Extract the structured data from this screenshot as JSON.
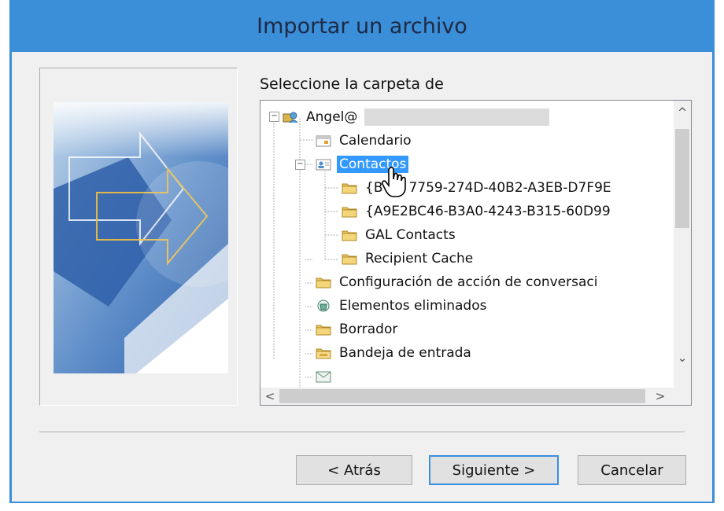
{
  "window": {
    "title": "Importar un archivo"
  },
  "prompt": "Seleccione la carpeta de",
  "tree": {
    "items": [
      {
        "label": "Angel@",
        "icon": "account-icon",
        "redacted": true
      },
      {
        "label": "Calendario",
        "icon": "calendar-icon"
      },
      {
        "label": "Contactos",
        "icon": "contacts-icon",
        "selected": true
      },
      {
        "label": "{B",
        "label_after_cursor": "7759-274D-40B2-A3EB-D7F9E",
        "icon": "folder-icon"
      },
      {
        "label": "{A9E2BC46-B3A0-4243-B315-60D99",
        "icon": "folder-icon"
      },
      {
        "label": "GAL Contacts",
        "icon": "folder-icon"
      },
      {
        "label": "Recipient Cache",
        "icon": "folder-icon"
      },
      {
        "label": "Configuración de acción de conversaci",
        "icon": "folder-icon"
      },
      {
        "label": "Elementos eliminados",
        "icon": "recycle-bin-icon"
      },
      {
        "label": "Borrador",
        "icon": "folder-icon"
      },
      {
        "label": "Bandeja de entrada",
        "icon": "inbox-icon"
      }
    ]
  },
  "scroll": {
    "up": "^",
    "down": "⌄",
    "left": "<",
    "right": ">"
  },
  "buttons": {
    "back": "< Atrás",
    "next": "Siguiente >",
    "cancel": "Cancelar"
  },
  "colors": {
    "title_bar": "#3b8ed8",
    "selection": "#3399ff",
    "default_button_border": "#3c8fe0"
  }
}
